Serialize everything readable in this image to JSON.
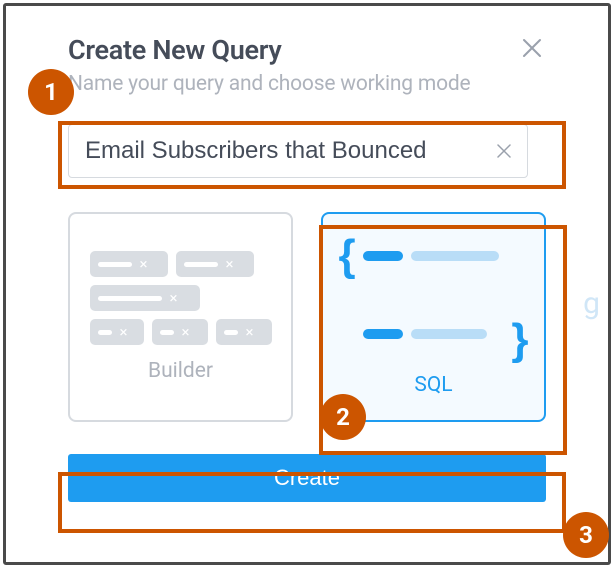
{
  "modal": {
    "title": "Create New Query",
    "subtitle": "Name your query and choose working mode",
    "close_icon": "close",
    "name_field": {
      "value": "Email Subscribers that Bounced",
      "clear_icon": "close"
    },
    "options": {
      "builder": {
        "label": "Builder",
        "selected": false
      },
      "sql": {
        "label": "SQL",
        "selected": true
      }
    },
    "create_button": "Create"
  },
  "annotations": {
    "step1": "1",
    "step2": "2",
    "step3": "3"
  },
  "colors": {
    "accent": "#1e9cf0",
    "annotation": "#cc5500"
  }
}
